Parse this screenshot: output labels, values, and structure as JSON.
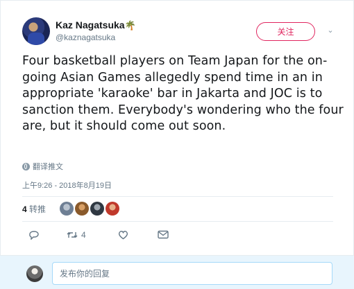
{
  "user": {
    "display_name": "Kaz Nagatsuka",
    "emoji": "🌴",
    "handle": "@kaznagatsuka",
    "follow_label": "关注",
    "caret": "⌄"
  },
  "tweet": {
    "text": "Four basketball players on Team Japan for the on-going Asian Games allegedly spend time in an in appropriate 'karaoke' bar in Jakarta and JOC is to sanction them. Everybody's wondering who the four are, but it should come out soon.",
    "translate_label": "翻译推文",
    "timestamp": "上午9:26 - 2018年8月19日"
  },
  "stats": {
    "retweet_count": "4",
    "retweet_label": "转推"
  },
  "actions": {
    "retweet_count": "4"
  },
  "reply": {
    "placeholder": "发布你的回复"
  },
  "colors": {
    "follow_accent": "#e0245e",
    "reply_bar_bg": "#e8f5fd",
    "secondary_text": "#657786"
  }
}
